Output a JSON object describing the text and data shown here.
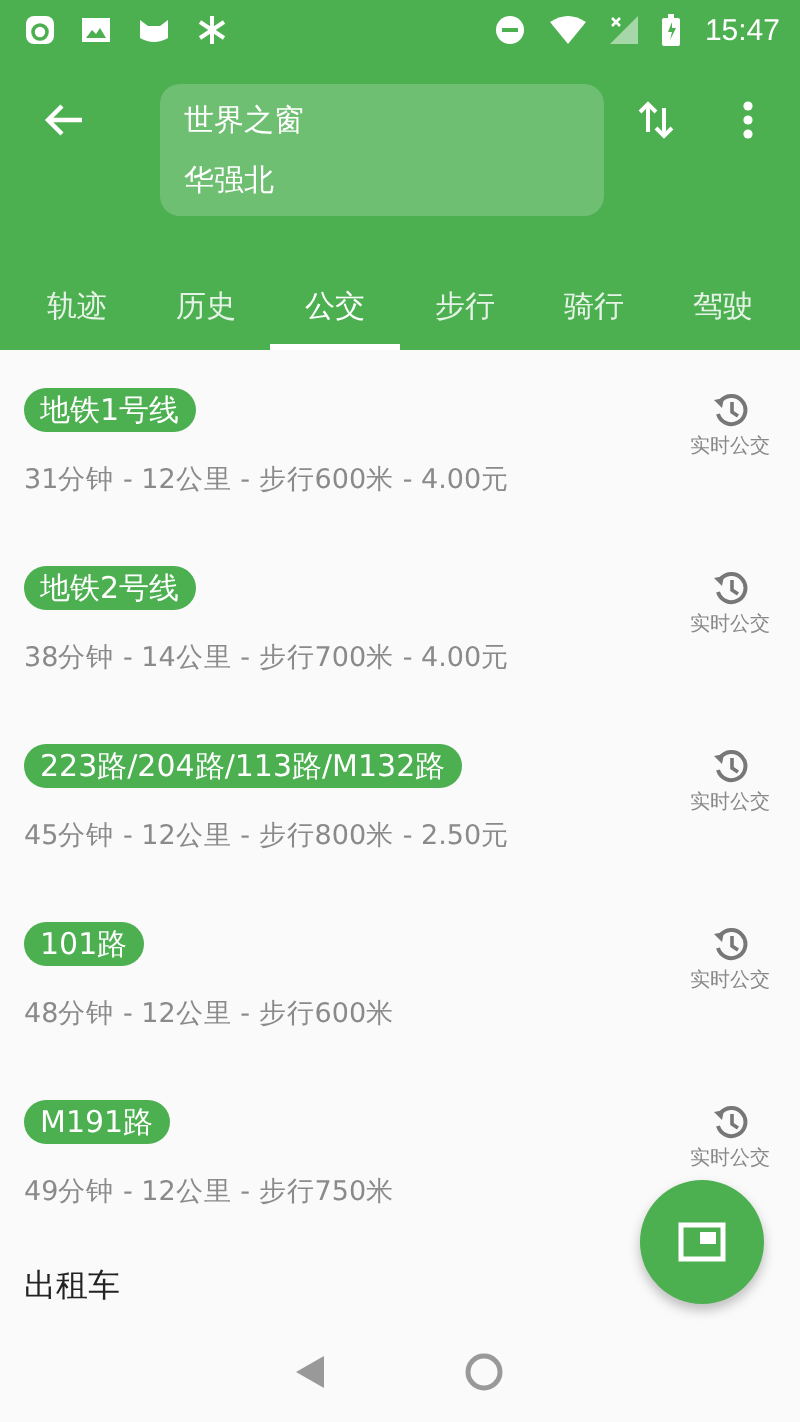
{
  "status_bar": {
    "time": "15:47"
  },
  "header": {
    "origin": "世界之窗",
    "destination": "华强北"
  },
  "tabs": [
    {
      "label": "轨迹",
      "selected": false
    },
    {
      "label": "历史",
      "selected": false
    },
    {
      "label": "公交",
      "selected": true
    },
    {
      "label": "步行",
      "selected": false
    },
    {
      "label": "骑行",
      "selected": false
    },
    {
      "label": "驾驶",
      "selected": false
    }
  ],
  "routes": [
    {
      "name": "地铁1号线",
      "summary": "31分钟 - 12公里 - 步行600米 - 4.00元",
      "realtime": "实时公交"
    },
    {
      "name": "地铁2号线",
      "summary": "38分钟 - 14公里 - 步行700米 - 4.00元",
      "realtime": "实时公交"
    },
    {
      "name": "223路/204路/113路/M132路",
      "summary": "45分钟 - 12公里 - 步行800米 - 2.50元",
      "realtime": "实时公交"
    },
    {
      "name": "101路",
      "summary": "48分钟 - 12公里 - 步行600米",
      "realtime": "实时公交"
    },
    {
      "name": "M191路",
      "summary": "49分钟 - 12公里 - 步行750米",
      "realtime": "实时公交"
    }
  ],
  "section_title": "出租车"
}
